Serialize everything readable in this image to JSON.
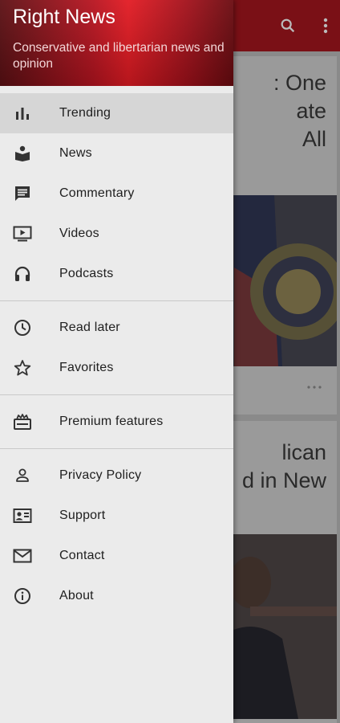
{
  "app": {
    "title": "Right News",
    "subtitle": "Conservative and libertarian news and opinion",
    "accent_color": "#e31b23"
  },
  "background": {
    "card1_title": ": One\nate\nAll",
    "card2_title": "lican\nd in New",
    "toolbar_icons": [
      "search-icon",
      "more-vert-icon"
    ]
  },
  "drawer": {
    "groups": [
      [
        {
          "label": "Trending",
          "icon": "trending-icon",
          "active": true
        },
        {
          "label": "News",
          "icon": "news-reader-icon"
        },
        {
          "label": "Commentary",
          "icon": "comment-icon"
        },
        {
          "label": "Videos",
          "icon": "video-icon"
        },
        {
          "label": "Podcasts",
          "icon": "headphones-icon"
        }
      ],
      [
        {
          "label": "Read later",
          "icon": "clock-icon"
        },
        {
          "label": "Favorites",
          "icon": "star-icon"
        }
      ],
      [
        {
          "label": "Premium features",
          "icon": "premium-icon"
        }
      ],
      [
        {
          "label": "Privacy Policy",
          "icon": "person-icon"
        },
        {
          "label": "Support",
          "icon": "contact-card-icon"
        },
        {
          "label": "Contact",
          "icon": "mail-icon"
        },
        {
          "label": "About",
          "icon": "info-icon"
        }
      ]
    ]
  }
}
